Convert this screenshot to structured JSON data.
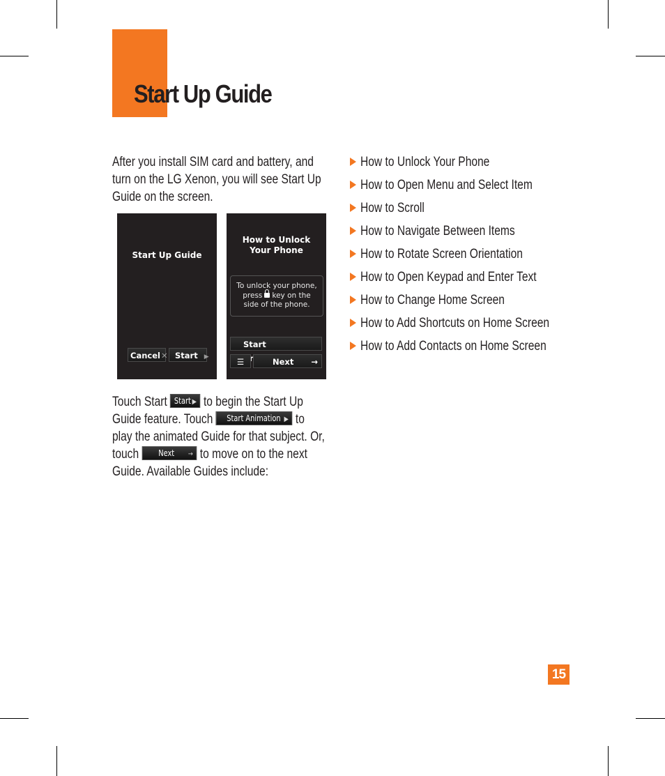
{
  "page": {
    "title": "Start Up Guide",
    "page_number": "15",
    "accent_color": "#f37721"
  },
  "intro": {
    "lines": [
      "After you install SIM card and battery, and",
      "turn on the LG Xenon, you will see Start Up",
      "Guide on the screen."
    ]
  },
  "screens": {
    "screen1": {
      "title": "Start Up Guide",
      "cancel_label": "Cancel",
      "cancel_icon": "close-icon",
      "start_label": "Start",
      "start_icon": "play-arrow-icon"
    },
    "screen2": {
      "title_line1": "How to Unlock",
      "title_line2": "Your Phone",
      "message_line1": "To unlock your phone,",
      "message_line2a": "press",
      "message_line2b": "key on the",
      "message_icon": "lock-icon",
      "message_line3": "side of the phone.",
      "start_animation_label": "Start Animation",
      "menu_icon": "list-icon",
      "next_label": "Next",
      "next_icon": "arrow-right-icon"
    }
  },
  "touch_paragraph": {
    "l1a": "Touch Start",
    "btn_start": "Start",
    "l1b": "to begin the Start Up",
    "l2a": "Guide feature. Touch",
    "btn_start_animation": "Start Animation",
    "l2b": "to",
    "l3": "play the animated Guide for that subject. Or,",
    "l4a": "touch",
    "btn_next": "Next",
    "l4b": "to move on to the next",
    "l5": "Guide. Available Guides include:"
  },
  "guides": [
    "How to Unlock Your Phone",
    "How to Open Menu and Select Item",
    "How to Scroll",
    "How to Navigate Between Items",
    "How to Rotate Screen Orientation",
    "How to Open Keypad and Enter Text",
    "How to Change Home Screen",
    "How to Add Shortcuts on Home Screen",
    "How to Add Contacts on Home Screen"
  ]
}
